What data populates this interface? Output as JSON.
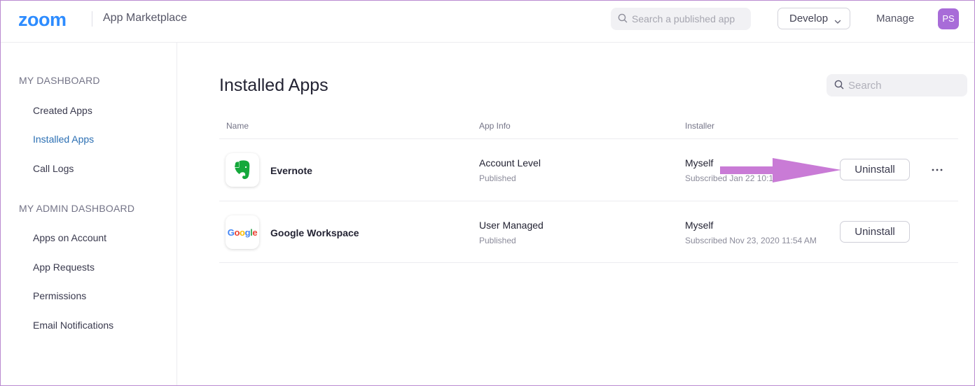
{
  "header": {
    "logo": "zoom",
    "app_title": "App Marketplace",
    "search_placeholder": "Search a published app",
    "develop_label": "Develop",
    "manage_label": "Manage",
    "avatar_initials": "PS",
    "brand_color": "#2d8cff",
    "avatar_color": "#a86cd8"
  },
  "sidebar": {
    "sections": [
      {
        "heading": "MY DASHBOARD",
        "items": [
          {
            "label": "Created Apps",
            "active": false
          },
          {
            "label": "Installed Apps",
            "active": true
          },
          {
            "label": "Call Logs",
            "active": false
          }
        ]
      },
      {
        "heading": "MY ADMIN DASHBOARD",
        "items": [
          {
            "label": "Apps on Account",
            "active": false
          },
          {
            "label": "App Requests",
            "active": false
          },
          {
            "label": "Permissions",
            "active": false
          },
          {
            "label": "Email Notifications",
            "active": false
          }
        ]
      }
    ]
  },
  "main": {
    "title": "Installed Apps",
    "search_placeholder": "Search",
    "columns": [
      "Name",
      "App Info",
      "Installer"
    ],
    "rows": [
      {
        "name": "Evernote",
        "icon": "evernote-elephant-icon",
        "app_info": "Account Level",
        "status": "Published",
        "installer": "Myself",
        "subscribed": "Subscribed Jan 22 10:11",
        "action": "Uninstall",
        "has_more_menu": true
      },
      {
        "name": "Google Workspace",
        "icon": "google-logo-icon",
        "app_info": "User Managed",
        "status": "Published",
        "installer": "Myself",
        "subscribed": "Subscribed Nov 23, 2020 11:54 AM",
        "action": "Uninstall",
        "has_more_menu": false
      }
    ]
  },
  "annotation": {
    "type": "arrow-pointing-to-uninstall",
    "color": "#c97bd6"
  }
}
